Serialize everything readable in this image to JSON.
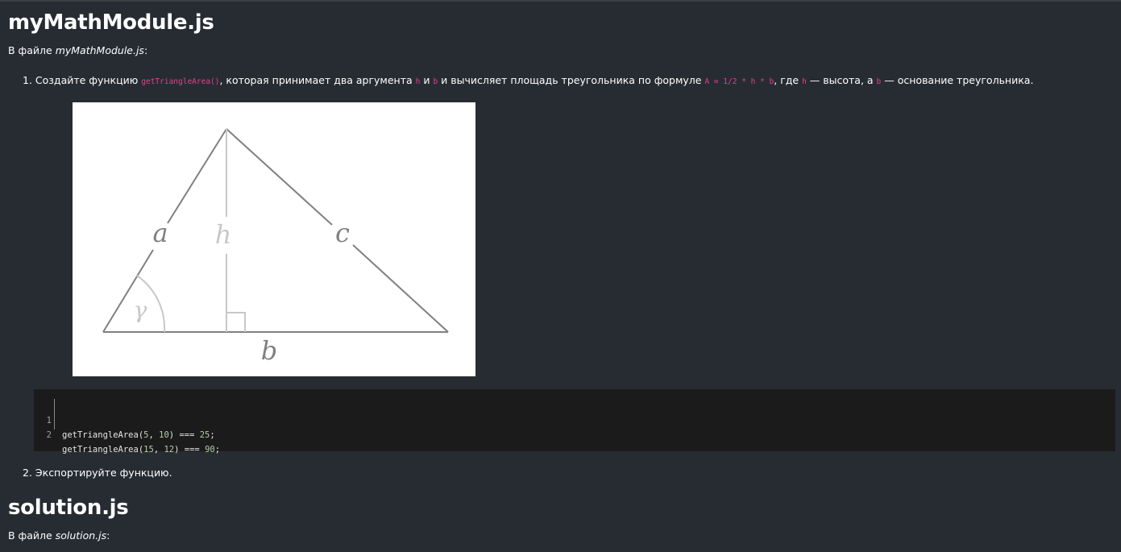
{
  "section1": {
    "title": "myMathModule.js",
    "intro_prefix": "В файле ",
    "intro_file": "myMathModule.js",
    "intro_suffix": ":"
  },
  "list1": {
    "item1": {
      "number": "1.",
      "text_a": " Создайте функцию ",
      "code_func": "getTriangleArea()",
      "text_b": ", которая принимает два аргумента ",
      "code_h": "h",
      "text_c": " и ",
      "code_b": "b",
      "text_d": " и вычисляет площадь треугольника по формуле ",
      "code_formula": "A = 1/2 * h * b",
      "text_e": ", где ",
      "code_h2": "h",
      "text_f": " — высота, а ",
      "code_b2": "b",
      "text_g": " — основание треугольника."
    },
    "figure": {
      "label_a": "a",
      "label_b": "b",
      "label_c": "c",
      "label_h": "h",
      "label_gamma": "γ"
    },
    "code": [
      {
        "line": "1",
        "fn": "getTriangleArea(",
        "arg1": "5",
        "sep": ", ",
        "arg2": "10",
        "mid": ") === ",
        "result": "25",
        "end": ";"
      },
      {
        "line": "2",
        "fn": "getTriangleArea(",
        "arg1": "15",
        "sep": ", ",
        "arg2": "12",
        "mid": ") === ",
        "result": "90",
        "end": ";"
      }
    ],
    "item2": {
      "number": "2.",
      "text": " Экспортируйте функцию."
    }
  },
  "section2": {
    "title": "solution.js",
    "intro_prefix": "В файле ",
    "intro_file": "solution.js",
    "intro_suffix": ":"
  },
  "colors": {
    "background": "#272c33",
    "inline_code": "#e83e8c",
    "code_background": "#1b1b1b"
  }
}
